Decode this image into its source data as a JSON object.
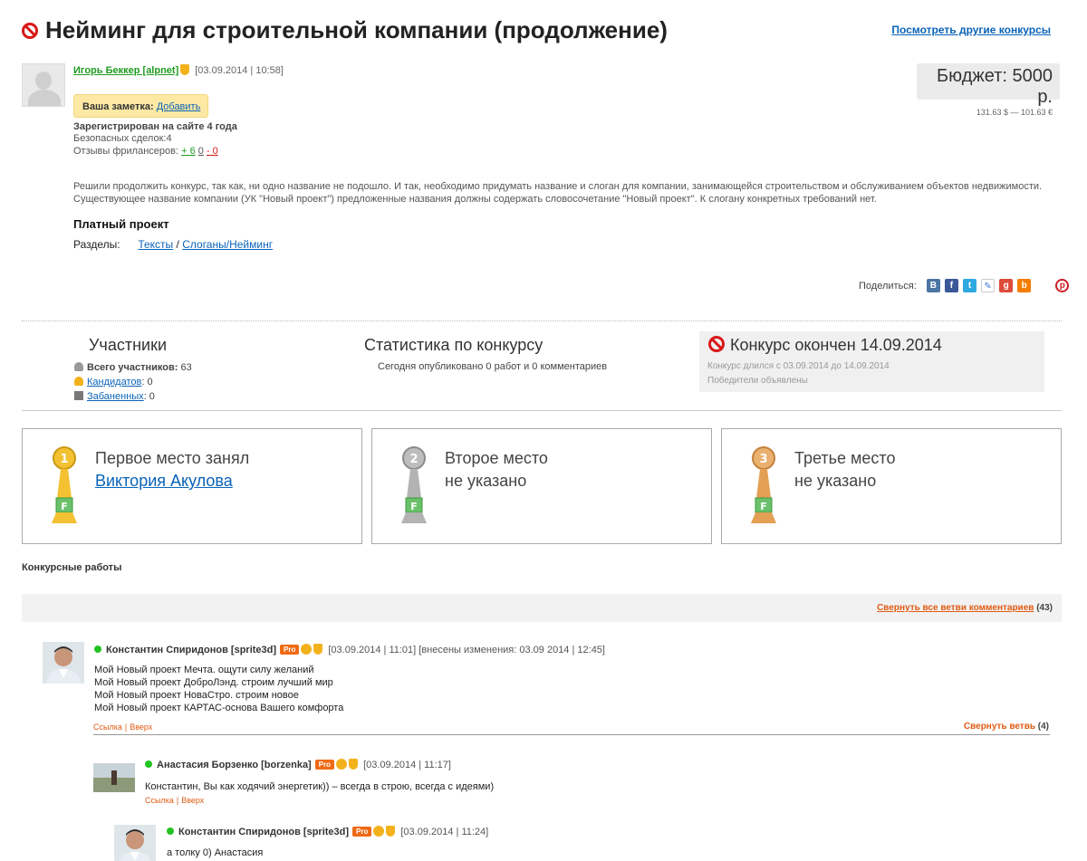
{
  "header": {
    "title": "Нейминг для строительной компании (продолжение)",
    "other_contests_link": "Посмотреть другие конкурсы"
  },
  "author": {
    "name": "Игорь Беккер [alpnet]",
    "datetime": "[03.09.2014 | 10:58]",
    "note_label": "Ваша заметка:",
    "note_add": "Добавить",
    "registered": "Зарегистрирован на сайте 4 года",
    "safe_deals": "Безопасных сделок:4",
    "reviews_label": "Отзывы фрилансеров:",
    "reviews_pos": "+ 6",
    "reviews_neutral": "0",
    "reviews_neg": "- 0"
  },
  "budget": {
    "value": "Бюджет: 5000 р.",
    "conversion": "131.63 $ — 101.63 €"
  },
  "project": {
    "description": "Решили продолжить конкурс, так как, ни одно название не подошло. И так, необходимо придумать название и слоган для компании, занимающейся строительством и обслуживанием объектов недвижимости. Существующее название компании (УК \"Новый проект\") предложенные названия должны содержать словосочетание \"Новый проект\". К слогану конкретных требований нет.",
    "paid": "Платный проект",
    "sections_label": "Разделы:",
    "section_1": "Тексты",
    "section_sep": "/",
    "section_2": "Слоганы/Нейминг"
  },
  "share": {
    "label": "Поделиться:"
  },
  "participants": {
    "title": "Участники",
    "total_label": "Всего участников:",
    "total_value": "63",
    "candidates_label": "Кандидатов",
    "candidates_value": ": 0",
    "banned_label": "Забаненных",
    "banned_value": ": 0"
  },
  "stats": {
    "title": "Статистика по конкурсу",
    "today": "Сегодня опубликовано 0 работ и 0 комментариев"
  },
  "ended": {
    "title": "Конкурс окончен 14.09.2014",
    "duration": "Конкурс длился с 03.09.2014 до 14.09.2014",
    "winners": "Победители объявлены"
  },
  "places": [
    {
      "line1": "Первое место занял",
      "winner": "Виктория Акулова",
      "color": "#f0c030"
    },
    {
      "line1": "Второе место",
      "line2": "не указано",
      "color": "#a8a8a8"
    },
    {
      "line1": "Третье место",
      "line2": "не указано",
      "color": "#e3a055"
    }
  ],
  "works": {
    "title": "Конкурсные работы",
    "collapse_all": "Свернуть все ветви комментариев",
    "collapse_count": "(43)"
  },
  "comments": [
    {
      "name": "Константин Спиридонов [sprite3d]",
      "pro": "Pro",
      "date": "[03.09.2014 | 11:01] [внесены изменения: 03.09 2014 | 12:45]",
      "lines": [
        "Мой Новый проект Мечта. ощути силу желаний",
        "Мой Новый проект ДоброЛэнд. строим лучший мир",
        "Мой Новый проект НоваСтро.  строим новое",
        "Мой Новый проект КАРТАС-основа Вашего комфорта"
      ],
      "link": "Ссылка",
      "up": "Вверх",
      "collapse": "Свернуть ветвь",
      "collapse_count": "(4)"
    },
    {
      "name": "Анастасия Борзенко [borzenka]",
      "pro": "Pro",
      "date": "[03.09.2014 | 11:17]",
      "text": "Константин, Вы как ходячий энергетик)) – всегда в строю, всегда с идеями)",
      "link": "Ссылка",
      "up": "Вверх"
    },
    {
      "name": "Константин Спиридонов [sprite3d]",
      "pro": "Pro",
      "date": "[03.09.2014 | 11:24]",
      "text": "а толку 0)  Анастасия"
    }
  ],
  "colors": {
    "link": "#0a63b8",
    "orange": "#e05b14",
    "green": "#1f9a1f",
    "red": "#d81818"
  }
}
